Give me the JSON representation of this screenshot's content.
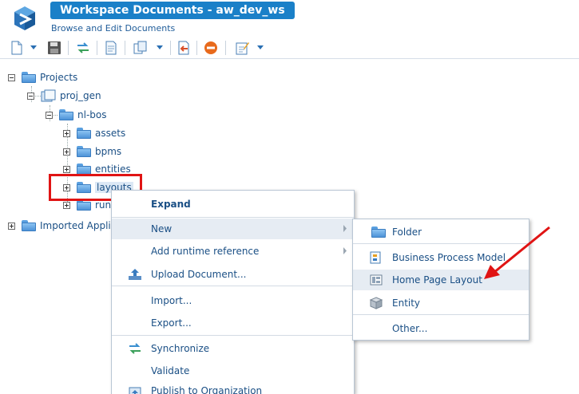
{
  "header": {
    "title": "Workspace Documents - aw_dev_ws",
    "subtitle": "Browse and Edit Documents"
  },
  "toolbar": {
    "icons": [
      "new-document-icon",
      "save-icon",
      "synchronize-icon",
      "document-icon",
      "copy-icon",
      "import-icon",
      "stop-icon",
      "edit-icon"
    ]
  },
  "tree": {
    "root": "Projects",
    "project": "proj_gen",
    "folder": "nl-bos",
    "children": [
      "assets",
      "bpms",
      "entities",
      "layouts",
      "run"
    ],
    "imported": "Imported Applic"
  },
  "context_menu": {
    "items": [
      "Expand",
      "New",
      "Add runtime reference",
      "Upload Document...",
      "Import...",
      "Export...",
      "Synchronize",
      "Validate",
      "Publish to Organization"
    ]
  },
  "submenu": {
    "items": [
      "Folder",
      "Business Process Model",
      "Home Page Layout",
      "Entity",
      "Other..."
    ]
  },
  "colors": {
    "accent": "#1a80c8",
    "highlight": "#e01414"
  }
}
